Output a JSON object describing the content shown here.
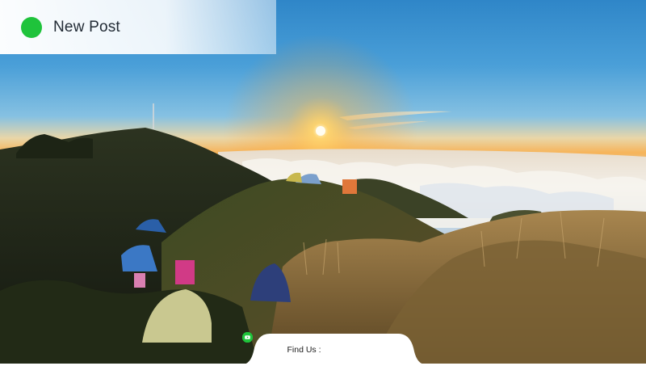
{
  "header": {
    "title": "New Post",
    "dot_color": "#1fc33b"
  },
  "footer": {
    "label": "Find Us :",
    "icons": [
      "facebook-icon",
      "instagram-icon",
      "twitter-icon",
      "youtube-icon"
    ],
    "icon_color": "#1fc33b"
  },
  "scene": {
    "description_tags": [
      "mountain-ridge",
      "sunrise",
      "sea-of-clouds",
      "camping-tents"
    ]
  }
}
